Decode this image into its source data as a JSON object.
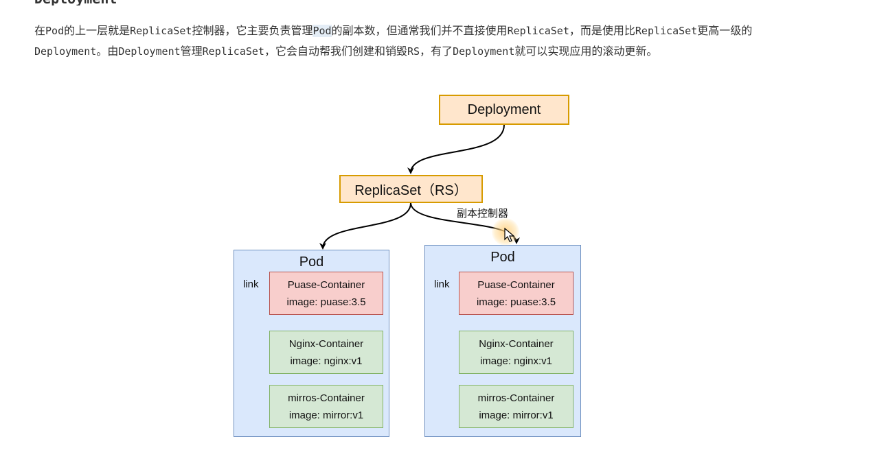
{
  "heading": "Deployment",
  "paragraph": {
    "segments": [
      {
        "t": "在",
        "code": false
      },
      {
        "t": "Pod",
        "code": true
      },
      {
        "t": "的上一层就是",
        "code": false
      },
      {
        "t": "ReplicaSet",
        "code": true
      },
      {
        "t": "控制器，它主要负责管理",
        "code": false
      },
      {
        "t": "Pod",
        "code": true,
        "highlight": true
      },
      {
        "t": "的副本数，但通常我们并不直接使用",
        "code": false
      },
      {
        "t": "ReplicaSet",
        "code": true
      },
      {
        "t": "，而是使用比",
        "code": false
      },
      {
        "t": "ReplicaSet",
        "code": true
      },
      {
        "t": "更高一级的",
        "code": false
      },
      {
        "t": "Deployment",
        "code": true
      },
      {
        "t": "。由",
        "code": false
      },
      {
        "t": "Deployment",
        "code": true
      },
      {
        "t": "管理",
        "code": false
      },
      {
        "t": "ReplicaSet",
        "code": true
      },
      {
        "t": "，它会自动帮我们创建和销毁",
        "code": false
      },
      {
        "t": "RS",
        "code": true
      },
      {
        "t": "，有了",
        "code": false
      },
      {
        "t": "Deployment",
        "code": true
      },
      {
        "t": "就可以实现应用的滚动更新。",
        "code": false
      }
    ]
  },
  "diagram": {
    "deployment_label": "Deployment",
    "replicaset_label": "ReplicaSet（RS）",
    "edge_label": "副本控制器",
    "pods": [
      {
        "title": "Pod",
        "link_label": "link",
        "pause": {
          "name": "Puase-Container",
          "image": "image: puase:3.5"
        },
        "nginx": {
          "name": "Nginx-Container",
          "image": "image: nginx:v1"
        },
        "mirror": {
          "name": "mirros-Container",
          "image": "image: mirror:v1"
        }
      },
      {
        "title": "Pod",
        "link_label": "link",
        "pause": {
          "name": "Puase-Container",
          "image": "image: puase:3.5"
        },
        "nginx": {
          "name": "Nginx-Container",
          "image": "image: nginx:v1"
        },
        "mirror": {
          "name": "mirros-Container",
          "image": "image: mirror:v1"
        }
      }
    ],
    "colors": {
      "orange_fill": "#ffe6cc",
      "orange_stroke": "#d79b00",
      "pod_fill": "#dae8fc",
      "pod_stroke": "#6c8ebf",
      "red_fill": "#f8cecc",
      "red_stroke": "#b85450",
      "green_fill": "#d5e8d4",
      "green_stroke": "#82b366"
    }
  }
}
